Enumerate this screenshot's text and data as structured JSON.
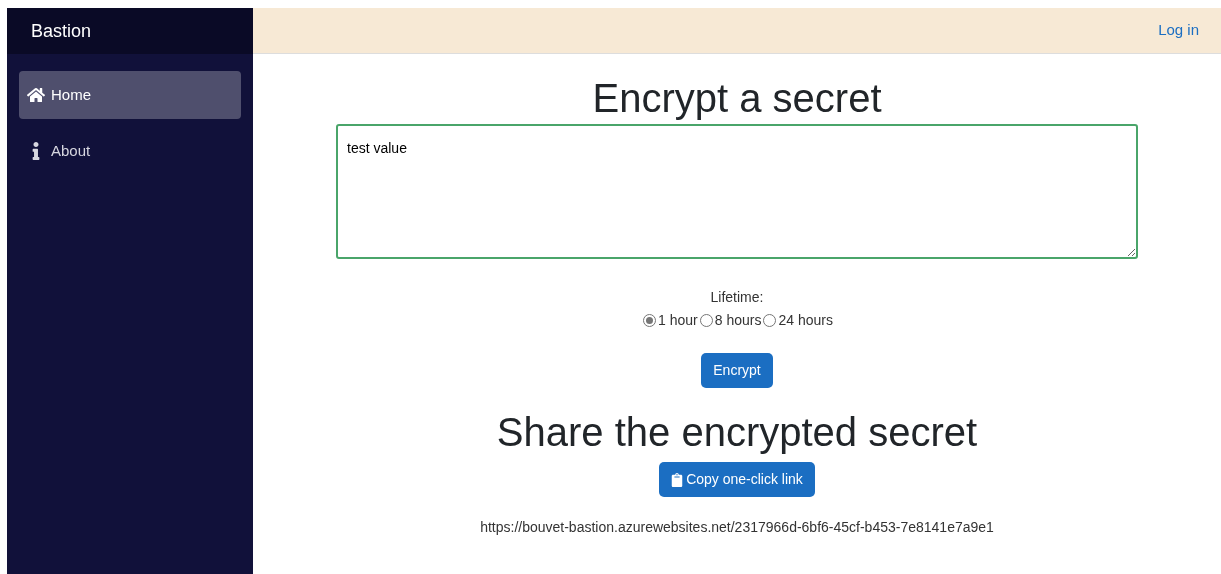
{
  "sidebar": {
    "brand": "Bastion",
    "items": [
      {
        "label": "Home",
        "kind": "home",
        "selected": true
      },
      {
        "label": "About",
        "kind": "info",
        "selected": false
      }
    ]
  },
  "top_bar": {
    "login_link": "Log in"
  },
  "encrypt": {
    "title": "Encrypt a secret",
    "secret_value": "test value",
    "lifetime_label": "Lifetime:",
    "lifetimes": [
      {
        "label": "1 hour",
        "selected": true
      },
      {
        "label": "8 hours",
        "selected": false
      },
      {
        "label": "24 hours",
        "selected": false
      }
    ],
    "button": "Encrypt"
  },
  "share": {
    "title": "Share the encrypted secret",
    "copy_button": "Copy one-click link",
    "link": "https://bouvet-bastion.azurewebsites.net/2317966d-6bf6-45cf-b453-7e8141e7a9e1"
  }
}
